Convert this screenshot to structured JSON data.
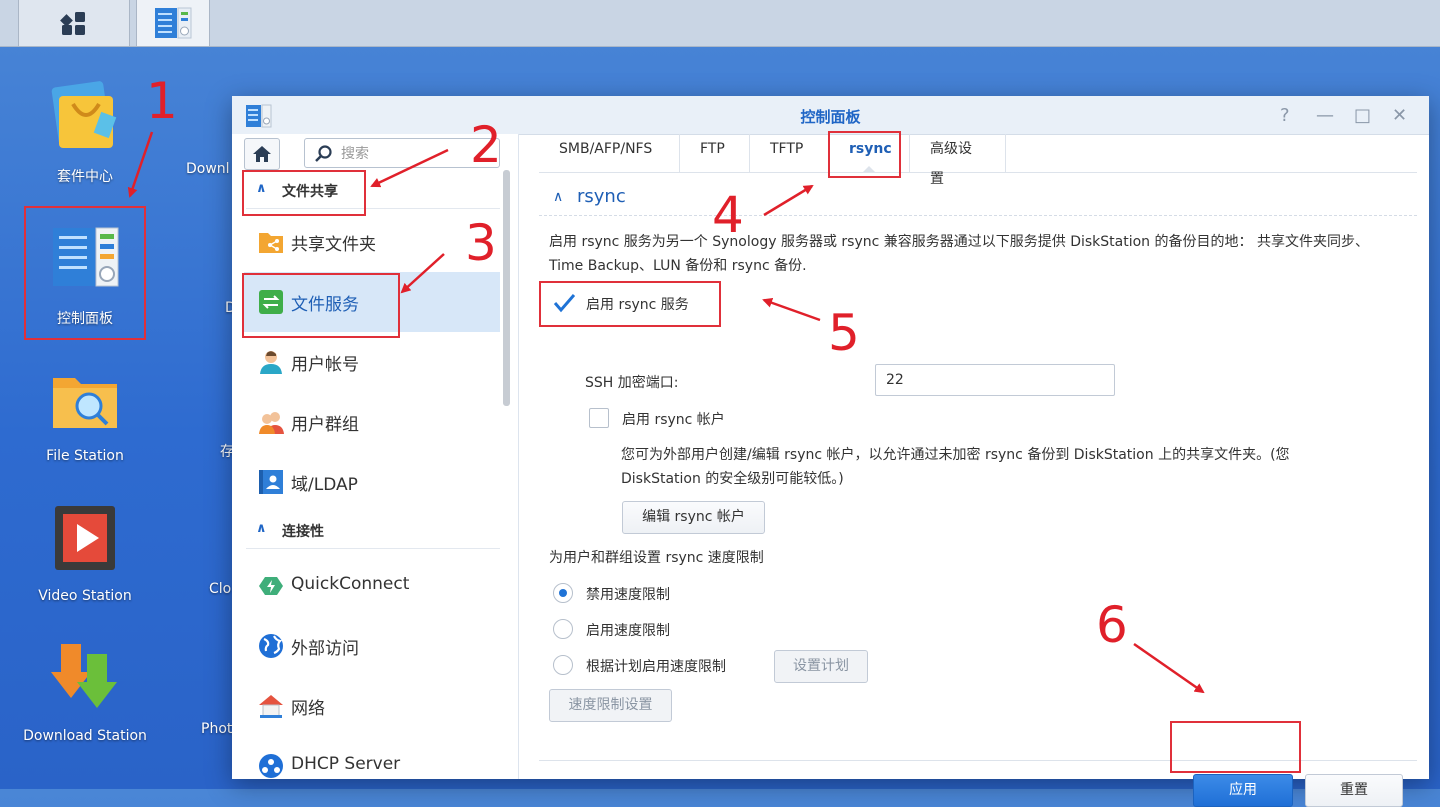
{
  "taskbar": {
    "main_menu_icon": "grid-icon",
    "control_panel_icon": "control-panel-icon"
  },
  "desktop": {
    "items": [
      {
        "label": "套件中心",
        "icon": "package-center-icon"
      },
      {
        "label": "控制面板",
        "icon": "control-panel-icon"
      },
      {
        "label": "File Station",
        "icon": "folder-search-icon"
      },
      {
        "label": "Video Station",
        "icon": "video-icon"
      },
      {
        "label": "Download Station",
        "icon": "download-icon"
      }
    ],
    "partial_labels": [
      "Downl",
      "D",
      "存",
      "Clo",
      "Phot"
    ]
  },
  "annotations": [
    "1",
    "2",
    "3",
    "4",
    "5",
    "6"
  ],
  "window": {
    "title": "控制面板",
    "controls": [
      "?",
      "—",
      "□",
      "✕"
    ]
  },
  "sidebar": {
    "search_placeholder": "搜索",
    "sections": [
      {
        "label": "文件共享"
      },
      {
        "label": "连接性"
      }
    ],
    "items": [
      {
        "label": "共享文件夹",
        "icon": "shared-folder-icon"
      },
      {
        "label": "文件服务",
        "icon": "file-services-icon"
      },
      {
        "label": "用户帐号",
        "icon": "user-icon"
      },
      {
        "label": "用户群组",
        "icon": "group-icon"
      },
      {
        "label": "域/LDAP",
        "icon": "domain-icon"
      },
      {
        "label": "QuickConnect",
        "icon": "quickconnect-icon"
      },
      {
        "label": "外部访问",
        "icon": "globe-icon"
      },
      {
        "label": "网络",
        "icon": "network-icon"
      },
      {
        "label": "DHCP Server",
        "icon": "dhcp-icon"
      }
    ]
  },
  "tabs": [
    "SMB/AFP/NFS",
    "FTP",
    "TFTP",
    "rsync",
    "高级设置"
  ],
  "active_tab": "rsync",
  "rsync": {
    "section_title": "rsync",
    "description_line1": "启用 rsync 服务为另一个 Synology 服务器或 rsync 兼容服务器通过以下服务提供 DiskStation 的备份目的地： 共享文件夹同步、",
    "description_line2": "Time Backup、LUN 备份和 rsync 备份.",
    "enable_service_label": "启用 rsync 服务",
    "enable_service_checked": true,
    "ssh_port_label": "SSH 加密端口:",
    "ssh_port_value": "22",
    "enable_account_label": "启用 rsync 帐户",
    "enable_account_checked": false,
    "account_desc_line1": "您可为外部用户创建/编辑 rsync 帐户，以允许通过未加密 rsync 备份到 DiskStation 上的共享文件夹。(您",
    "account_desc_line2": "DiskStation 的安全级别可能较低。)",
    "edit_account_button": "编辑 rsync 帐户",
    "speed_limit_heading": "为用户和群组设置 rsync 速度限制",
    "speed_options": [
      "禁用速度限制",
      "启用速度限制",
      "根据计划启用速度限制"
    ],
    "selected_speed_option": "禁用速度限制",
    "schedule_button": "设置计划",
    "speed_settings_button": "速度限制设置"
  },
  "footer": {
    "apply": "应用",
    "reset": "重置"
  },
  "colors": {
    "accent": "#1f5fb5",
    "annotation": "#e0202a",
    "primary_button": "#1f6fd6"
  }
}
